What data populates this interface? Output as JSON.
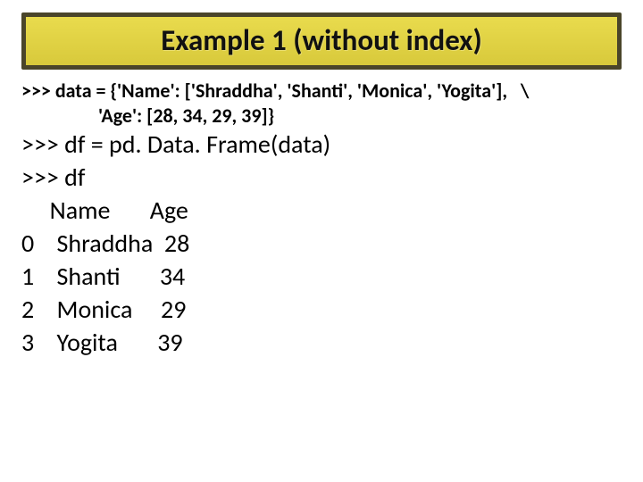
{
  "title": "Example 1 (without index)",
  "code": {
    "l1": ">>> data = {'Name': ['Shraddha', 'Shanti', 'Monica', 'Yogita'],   \\",
    "l2": "'Age': [28, 34, 29, 39]}",
    "l3": ">>> df = pd. Data. Frame(data)",
    "l4": ">>> df",
    "header": "     Name       Age",
    "r0": "0    Shraddha  28",
    "r1": "1    Shanti       34",
    "r2": "2    Monica     29",
    "r3": "3    Yogita       39"
  }
}
